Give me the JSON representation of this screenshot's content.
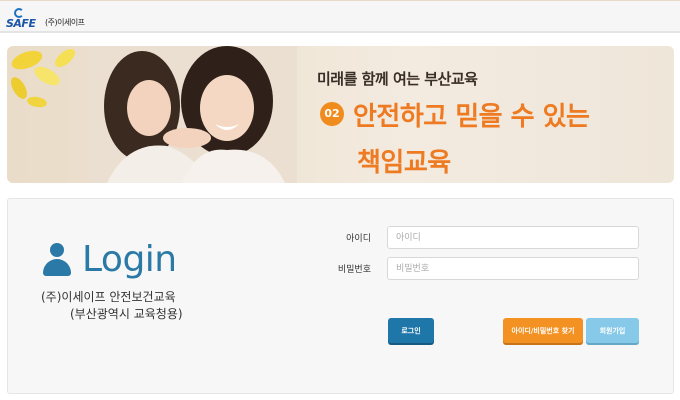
{
  "header": {
    "logo_word": "SAFE",
    "company": "(주)이세이프"
  },
  "banner": {
    "subtitle": "미래를 함께 여는 부산교육",
    "badge": "02",
    "line1": "안전하고 믿을 수 있는",
    "line2": "책임교육"
  },
  "login": {
    "title": "Login",
    "sub1": "(주)이세이프 안전보건교육",
    "sub2": "(부산광역시 교육청용)",
    "id_label": "아이디",
    "id_placeholder": "아이디",
    "pw_label": "비밀번호",
    "pw_placeholder": "비밀번호",
    "login_button": "로그인",
    "find_button": "아이디/비밀번호 찾기",
    "join_button": "회원가입"
  },
  "colors": {
    "brand_blue": "#2b79a6",
    "orange": "#ee7a22",
    "light_blue": "#86c9e8"
  }
}
